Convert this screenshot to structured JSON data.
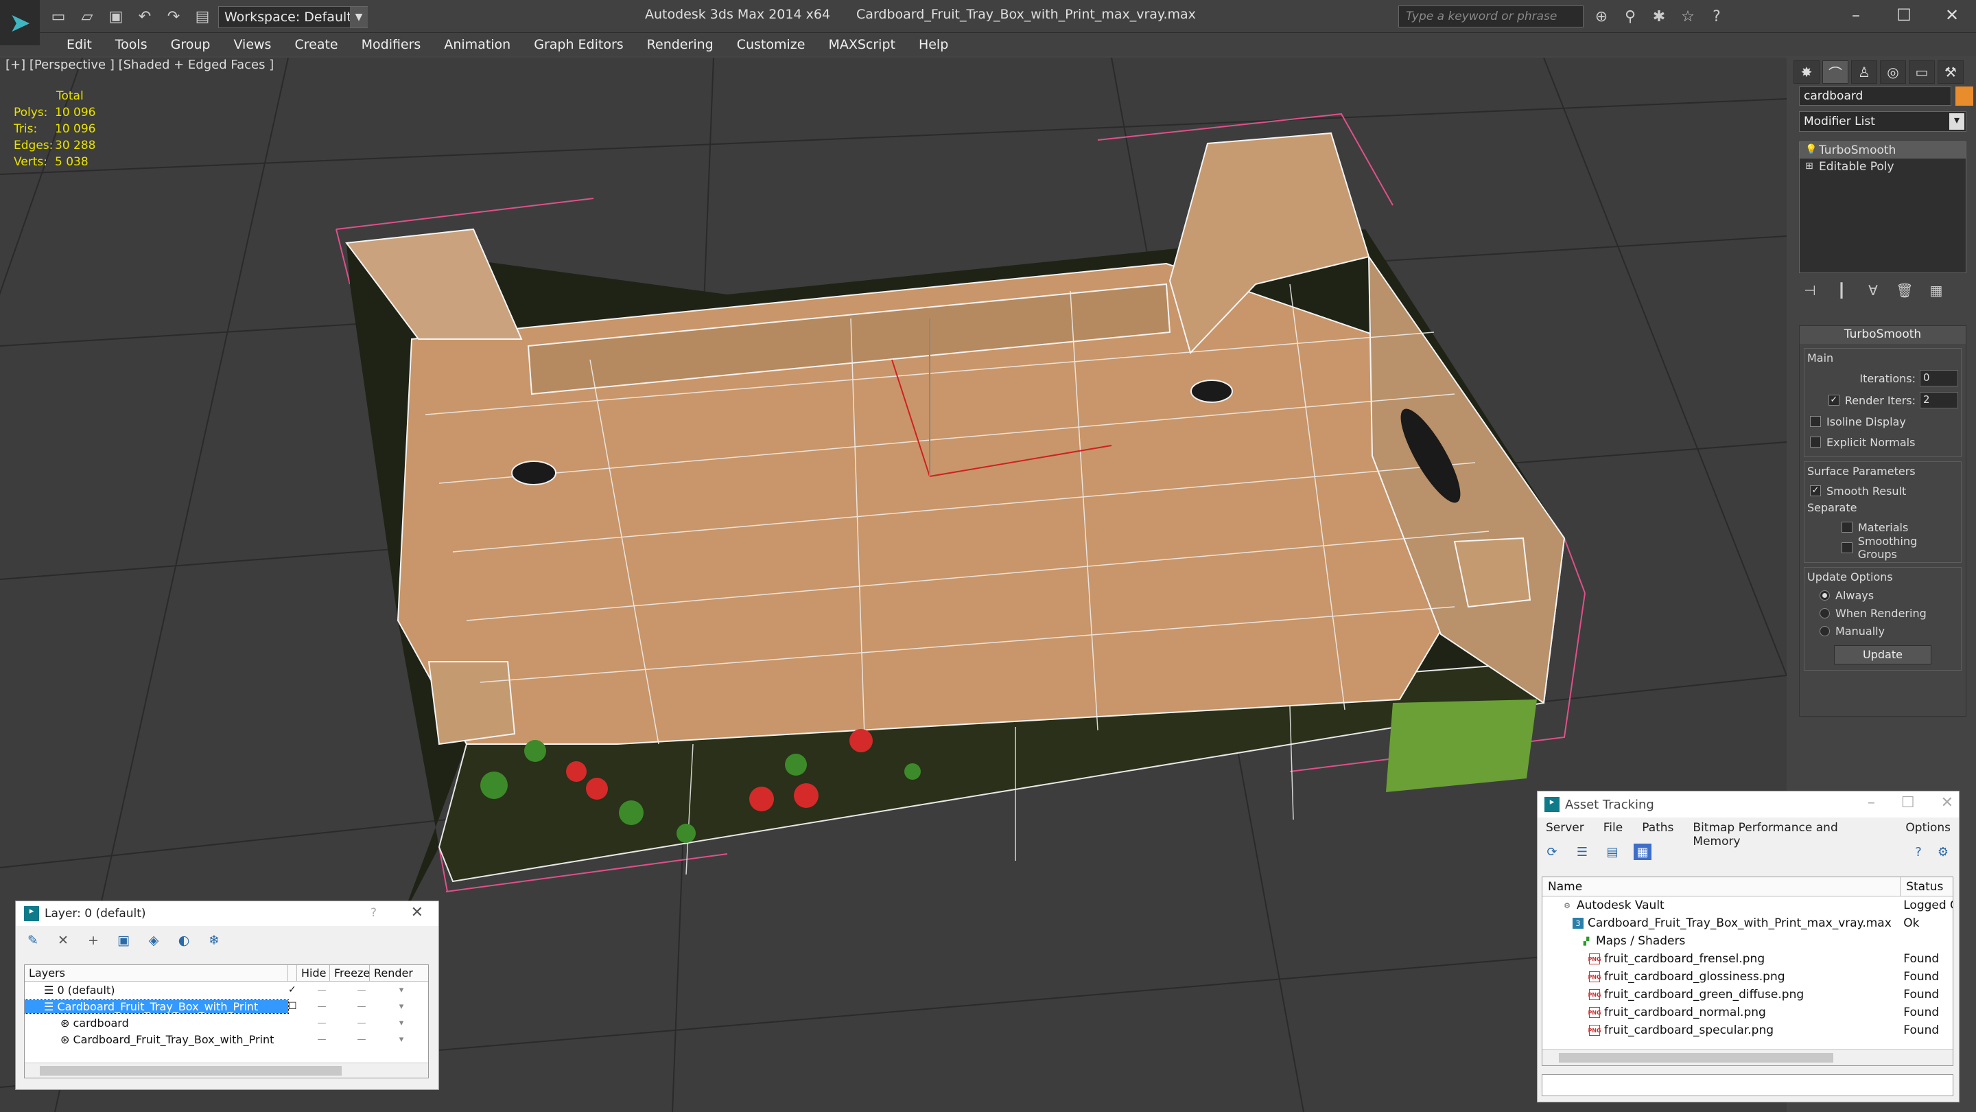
{
  "app": {
    "title": "Autodesk 3ds Max  2014 x64",
    "file": "Cardboard_Fruit_Tray_Box_with_Print_max_vray.max",
    "workspace": "Workspace: Default",
    "search_placeholder": "Type a keyword or phrase"
  },
  "menu": [
    "Edit",
    "Tools",
    "Group",
    "Views",
    "Create",
    "Modifiers",
    "Animation",
    "Graph Editors",
    "Rendering",
    "Customize",
    "MAXScript",
    "Help"
  ],
  "viewport": {
    "label": "[+] [Perspective ] [Shaded + Edged Faces ]",
    "stats": {
      "header": "Total",
      "rows": [
        {
          "k": "Polys:",
          "v": "10 096"
        },
        {
          "k": "Tris:",
          "v": "10 096"
        },
        {
          "k": "Edges:",
          "v": "30 288"
        },
        {
          "k": "Verts:",
          "v": "5 038"
        }
      ]
    }
  },
  "command_panel": {
    "object_name": "cardboard",
    "object_color": "#e88c2c",
    "modifier_list": "Modifier List",
    "stack": [
      "TurboSmooth",
      "Editable Poly"
    ],
    "rollout": {
      "title": "TurboSmooth",
      "main_label": "Main",
      "iterations_label": "Iterations:",
      "iterations": "0",
      "render_iters_label": "Render Iters:",
      "render_iters": "2",
      "isoline": "Isoline Display",
      "explicit_normals": "Explicit Normals",
      "surface_label": "Surface Parameters",
      "smooth_result": "Smooth Result",
      "separate_label": "Separate",
      "materials": "Materials",
      "smoothing_groups": "Smoothing Groups",
      "update_label": "Update Options",
      "always": "Always",
      "when_rendering": "When Rendering",
      "manually": "Manually",
      "update_button": "Update"
    }
  },
  "layer_window": {
    "title": "Layer: 0 (default)",
    "help": "?",
    "columns": [
      "Layers",
      "Hide",
      "Freeze",
      "Render"
    ],
    "rows": [
      {
        "name": "0 (default)",
        "indent": 1
      },
      {
        "name": "Cardboard_Fruit_Tray_Box_with_Print",
        "indent": 1,
        "selected": true
      },
      {
        "name": "cardboard",
        "indent": 2
      },
      {
        "name": "Cardboard_Fruit_Tray_Box_with_Print",
        "indent": 2
      }
    ]
  },
  "asset_tracking": {
    "title": "Asset Tracking",
    "menu": [
      "Server",
      "File",
      "Paths",
      "Bitmap Performance and Memory",
      "Options"
    ],
    "columns": [
      "Name",
      "Status"
    ],
    "rows": [
      {
        "name": "Autodesk Vault",
        "status": "Logged O",
        "indent": 0,
        "icon": "vault"
      },
      {
        "name": "Cardboard_Fruit_Tray_Box_with_Print_max_vray.max",
        "status": "Ok",
        "indent": 1,
        "icon": "max"
      },
      {
        "name": "Maps / Shaders",
        "status": "",
        "indent": 2,
        "icon": "maps"
      },
      {
        "name": "fruit_cardboard_frensel.png",
        "status": "Found",
        "indent": 3,
        "icon": "png"
      },
      {
        "name": "fruit_cardboard_glossiness.png",
        "status": "Found",
        "indent": 3,
        "icon": "png"
      },
      {
        "name": "fruit_cardboard_green_diffuse.png",
        "status": "Found",
        "indent": 3,
        "icon": "png"
      },
      {
        "name": "fruit_cardboard_normal.png",
        "status": "Found",
        "indent": 3,
        "icon": "png"
      },
      {
        "name": "fruit_cardboard_specular.png",
        "status": "Found",
        "indent": 3,
        "icon": "png"
      }
    ]
  }
}
